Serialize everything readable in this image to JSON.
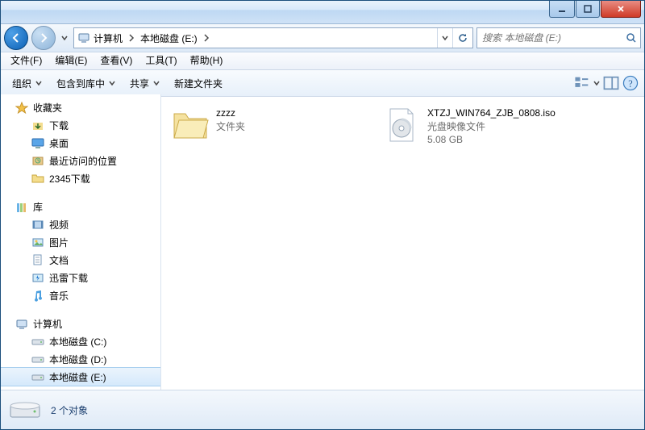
{
  "titlebar": {
    "minimize": "",
    "maximize": "",
    "close": ""
  },
  "nav": {
    "breadcrumbs": [
      {
        "icon": "computer-icon",
        "label": "计算机"
      },
      {
        "label": "本地磁盘 (E:)"
      }
    ],
    "search_placeholder": "搜索 本地磁盘 (E:)"
  },
  "menubar": [
    {
      "key": "file",
      "label": "文件(F)"
    },
    {
      "key": "edit",
      "label": "编辑(E)"
    },
    {
      "key": "view",
      "label": "查看(V)"
    },
    {
      "key": "tools",
      "label": "工具(T)"
    },
    {
      "key": "help",
      "label": "帮助(H)"
    }
  ],
  "toolbar": {
    "organize": "组织",
    "include": "包含到库中",
    "share": "共享",
    "newfolder": "新建文件夹"
  },
  "navpane": {
    "favorites": {
      "label": "收藏夹",
      "items": [
        {
          "icon": "download-icon",
          "label": "下载"
        },
        {
          "icon": "desktop-icon",
          "label": "桌面"
        },
        {
          "icon": "recent-icon",
          "label": "最近访问的位置"
        },
        {
          "icon": "folder-icon",
          "label": "2345下载"
        }
      ]
    },
    "libraries": {
      "label": "库",
      "items": [
        {
          "icon": "video-icon",
          "label": "视频"
        },
        {
          "icon": "pictures-icon",
          "label": "图片"
        },
        {
          "icon": "documents-icon",
          "label": "文档"
        },
        {
          "icon": "xunlei-icon",
          "label": "迅雷下载"
        },
        {
          "icon": "music-icon",
          "label": "音乐"
        }
      ]
    },
    "computer": {
      "label": "计算机",
      "items": [
        {
          "icon": "drive-icon",
          "label": "本地磁盘 (C:)"
        },
        {
          "icon": "drive-icon",
          "label": "本地磁盘 (D:)"
        },
        {
          "icon": "drive-icon",
          "label": "本地磁盘 (E:)",
          "sel": true
        }
      ]
    }
  },
  "files": [
    {
      "type": "folder",
      "name": "zzzz",
      "sub1": "文件夹"
    },
    {
      "type": "iso",
      "name": "XTZJ_WIN764_ZJB_0808.iso",
      "sub1": "光盘映像文件",
      "sub2": "5.08 GB"
    }
  ],
  "statusbar": {
    "text": "2 个对象"
  }
}
